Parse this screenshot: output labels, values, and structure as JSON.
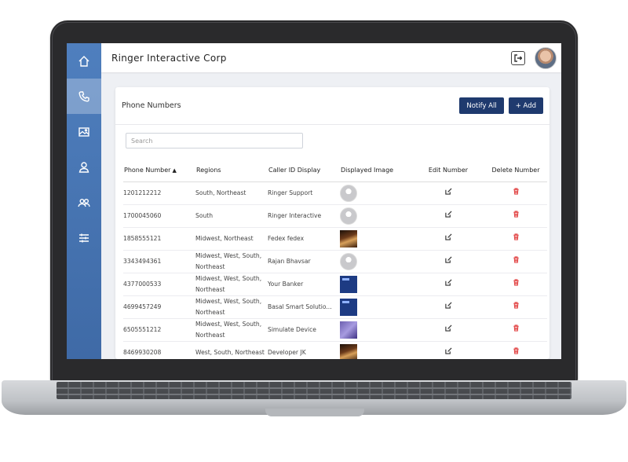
{
  "app": {
    "title": "Ringer Interactive Corp"
  },
  "sidebar": {
    "items": [
      {
        "name": "home-icon",
        "active": false
      },
      {
        "name": "phone-icon",
        "active": true
      },
      {
        "name": "image-icon",
        "active": false
      },
      {
        "name": "user-icon",
        "active": false
      },
      {
        "name": "users-icon",
        "active": false
      },
      {
        "name": "sliders-icon",
        "active": false
      }
    ]
  },
  "page": {
    "title": "Phone Numbers",
    "notify_label": "Notify All",
    "add_label": "+ Add",
    "search_placeholder": "Search"
  },
  "table": {
    "columns": [
      "Phone Number",
      "Regions",
      "Caller ID Display",
      "Displayed Image",
      "Edit Number",
      "Delete Number"
    ],
    "sort_indicator": "▲",
    "rows": [
      {
        "phone": "1201212212",
        "regions": "South, Northeast",
        "caller_id": "Ringer Support",
        "image": "avatar"
      },
      {
        "phone": "1700045060",
        "regions": "South",
        "caller_id": "Ringer Interactive",
        "image": "avatar"
      },
      {
        "phone": "1858555121",
        "regions": "Midwest, Northeast",
        "caller_id": "Fedex fedex",
        "image": "photo"
      },
      {
        "phone": "3343494361",
        "regions": "Midwest, West, South, Northeast",
        "caller_id": "Rajan Bhavsar",
        "image": "avatar"
      },
      {
        "phone": "4377000533",
        "regions": "Midwest, West, South, Northeast",
        "caller_id": "Your Banker",
        "image": "logo"
      },
      {
        "phone": "4699457249",
        "regions": "Midwest, West, South, Northeast",
        "caller_id": "Basal Smart Solutio...",
        "image": "logo"
      },
      {
        "phone": "6505551212",
        "regions": "Midwest, West, South, Northeast",
        "caller_id": "Simulate Device",
        "image": "purple"
      },
      {
        "phone": "8469930208",
        "regions": "West, South, Northeast",
        "caller_id": "Developer JK",
        "image": "photo"
      }
    ]
  }
}
